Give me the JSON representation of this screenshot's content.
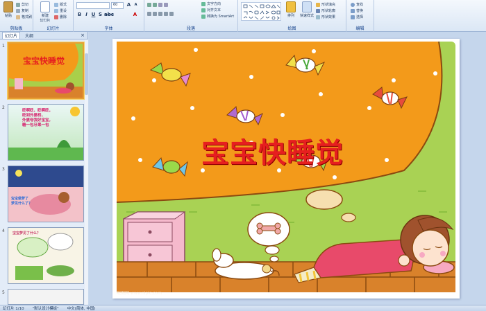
{
  "ribbon": {
    "clipboard": {
      "paste": "粘贴",
      "cut": "剪切",
      "copy": "复制",
      "format_painter": "格式刷",
      "group": "剪贴板"
    },
    "slides": {
      "new_slide": "新建\n幻灯片",
      "layout": "版式",
      "reset": "重设",
      "delete": "删除",
      "group": "幻灯片"
    },
    "font": {
      "name_value": "",
      "size_value": "60",
      "group": "字体"
    },
    "paragraph": {
      "text_direction": "文字方向",
      "align_text": "对齐文本",
      "smartart": "转换为 SmartArt",
      "group": "段落"
    },
    "drawing": {
      "arrange": "排列",
      "quick_styles": "快速样式",
      "shape_fill": "形状填充",
      "shape_outline": "形状轮廓",
      "shape_effects": "形状效果",
      "group": "绘图"
    },
    "editing": {
      "find": "查找",
      "replace": "替换",
      "select": "选择",
      "group": "编辑"
    }
  },
  "outline": {
    "tabs": [
      "幻灯片",
      "大纲"
    ],
    "close": "×",
    "slides": [
      {
        "num": "1",
        "title": "宝宝快睡觉"
      },
      {
        "num": "2",
        "text": "眨啊眨，眨啊眨，\n眨到外婆桥，\n外婆夸我好宝宝，\n糖一包牙果一包"
      },
      {
        "num": "3",
        "text": "宝宝做梦了\n梦见什么了？"
      },
      {
        "num": "4",
        "text": "宝宝梦见了什么？"
      },
      {
        "num": "5"
      }
    ]
  },
  "slide": {
    "title": "宝宝快睡觉",
    "watermark": "昵图网 www.nipic.com"
  },
  "status": {
    "slide_counter": "幻灯片 1/10",
    "theme": "\"默认设计模板\"",
    "language": "中文(简体, 中国)"
  },
  "colors": {
    "ribbon_blue": "#dbe7f5",
    "selected_thumb": "#e8a033",
    "title_red": "#e61f1f",
    "orange_bg": "#f39a1a"
  }
}
